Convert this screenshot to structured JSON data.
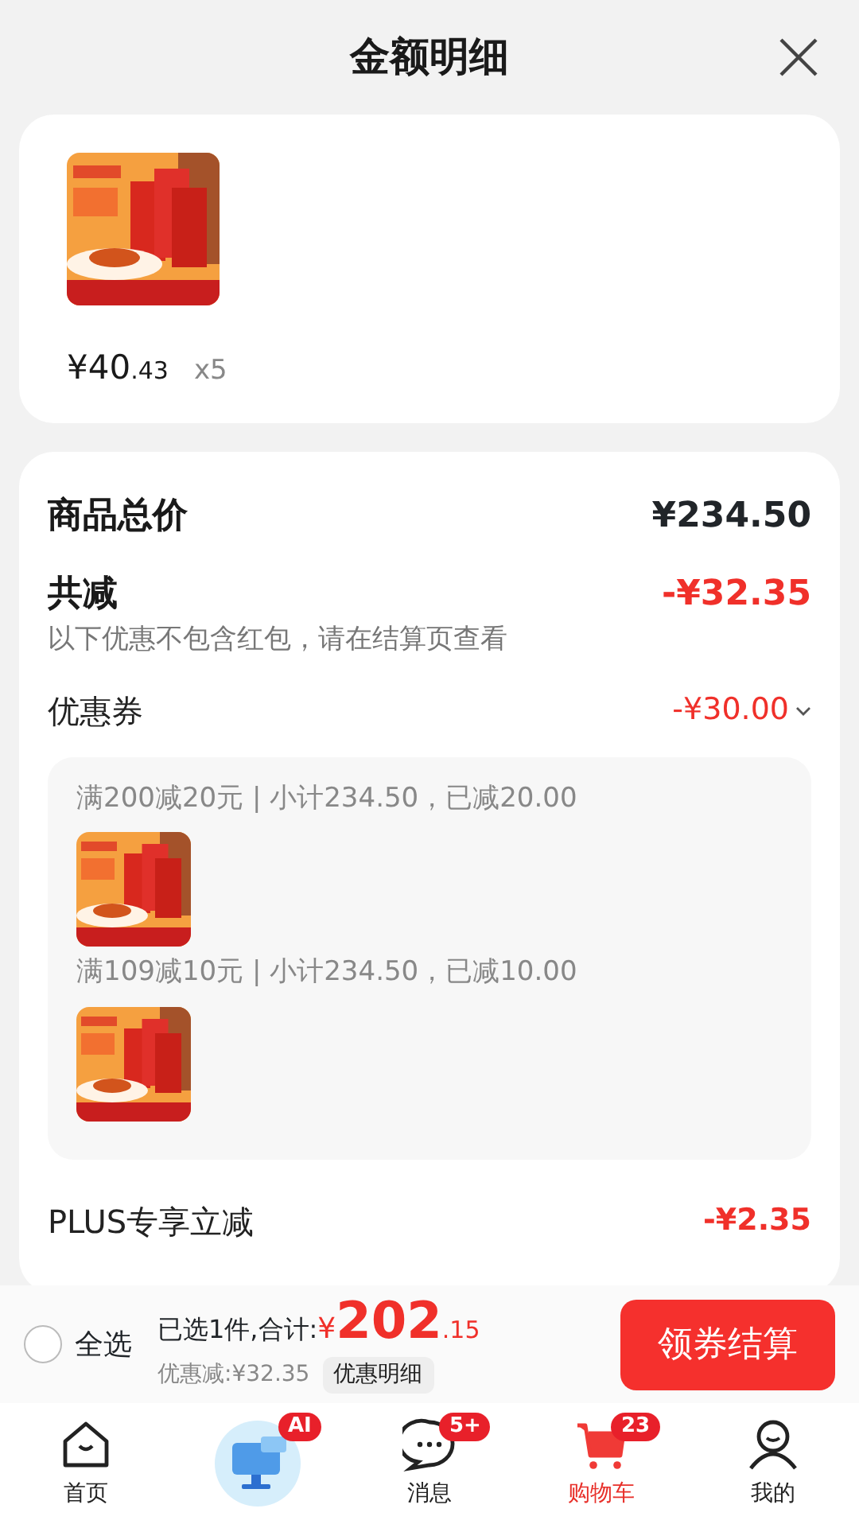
{
  "header": {
    "title": "金额明细"
  },
  "product": {
    "kind": "picture",
    "price_int": "¥40",
    "price_dec": ".43",
    "quantity": "x5"
  },
  "summary": {
    "total_label": "商品总价",
    "total_value": "¥234.50",
    "reduce_label": "共减",
    "reduce_value": "-¥32.35",
    "note": "以下优惠不包含红包，请在结算页查看"
  },
  "coupon": {
    "label": "优惠券",
    "value": "-¥30.00",
    "expanded": true,
    "rules": [
      {
        "text": "满200减20元 | 小计234.50，已减20.00",
        "kind": "picture"
      },
      {
        "text": "满109减10元 | 小计234.50，已减10.00",
        "kind": "picture"
      }
    ]
  },
  "plus": {
    "label": "PLUS专享立减",
    "value": "-¥2.35"
  },
  "checkout": {
    "select_all": "全选",
    "checked": false,
    "summary": "已选1件,合计:",
    "currency": "¥",
    "total_int": "202",
    "total_dec": ".15",
    "discount": "优惠减:¥32.35",
    "detail_button": "优惠明细",
    "button": "领券结算"
  },
  "tabs": [
    {
      "kind": "home",
      "label": "首页",
      "selected": false
    },
    {
      "kind": "ai",
      "badge": "AI",
      "selected": false
    },
    {
      "kind": "chat",
      "label": "消息",
      "badge": "5+",
      "selected": false
    },
    {
      "kind": "cart",
      "label": "购物车",
      "badge": "23",
      "selected": true
    },
    {
      "kind": "user",
      "label": "我的",
      "selected": false
    }
  ]
}
